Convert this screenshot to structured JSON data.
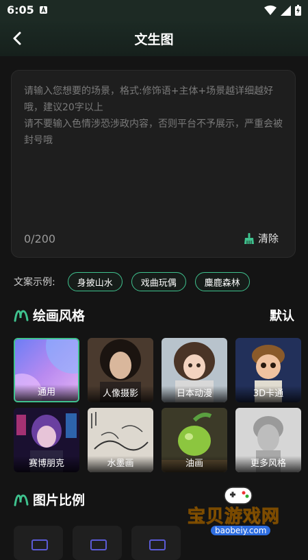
{
  "status_bar": {
    "time": "6:05"
  },
  "app_bar": {
    "title": "文生图"
  },
  "prompt": {
    "placeholder": "请输入您想要的场景，格式:修饰语+主体+场景越详细越好哦，建议20字以上\n请不要输入色情涉恐涉政内容，否则平台不予展示，严重会被封号哦",
    "counter": "0/200",
    "clear_label": "清除"
  },
  "examples": {
    "label": "文案示例:",
    "items": [
      "身披山水",
      "戏曲玩偶",
      "麋鹿森林"
    ]
  },
  "style_section": {
    "title": "绘画风格",
    "default_label": "默认",
    "selected_index": 0,
    "styles": [
      {
        "label": "通用",
        "icon": "gradient-abstract-thumb"
      },
      {
        "label": "人像摄影",
        "icon": "portrait-thumb"
      },
      {
        "label": "日本动漫",
        "icon": "anime-thumb"
      },
      {
        "label": "3D卡通",
        "icon": "cartoon-3d-thumb"
      },
      {
        "label": "赛博朋克",
        "icon": "cyberpunk-thumb"
      },
      {
        "label": "水墨画",
        "icon": "ink-painting-thumb"
      },
      {
        "label": "油画",
        "icon": "oil-painting-apple-thumb"
      },
      {
        "label": "更多风格",
        "icon": "sculpture-thumb"
      }
    ]
  },
  "ratio_section": {
    "title": "图片比例"
  },
  "watermark": {
    "text": "宝贝游戏网",
    "url": "baobeiy.com"
  },
  "colors": {
    "accent": "#3fc28e",
    "background": "#141414",
    "card": "#1e1e1e"
  }
}
